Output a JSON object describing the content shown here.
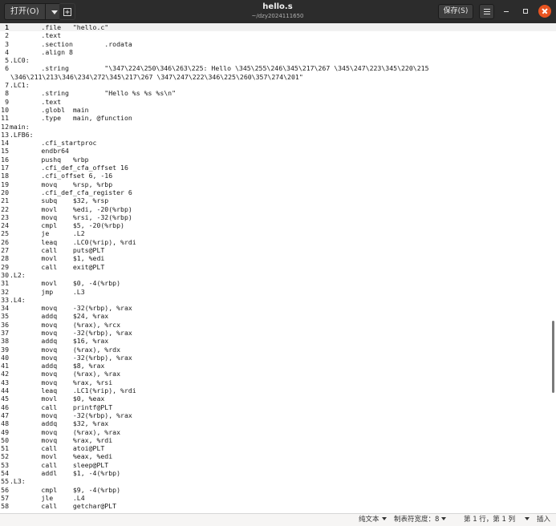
{
  "header": {
    "open_label": "打开(O)",
    "title": "hello.s",
    "subtitle": "~/dzy2024111650",
    "save_label": "保存(S)"
  },
  "editor": {
    "current_line": 1,
    "lines": [
      {
        "n": "1",
        "t": "        .file   \"hello.c\""
      },
      {
        "n": "2",
        "t": "        .text"
      },
      {
        "n": "3",
        "t": "        .section        .rodata"
      },
      {
        "n": "4",
        "t": "        .align 8"
      },
      {
        "n": "5",
        "t": ".LC0:"
      },
      {
        "n": "6",
        "t": "        .string         \"\\347\\224\\250\\346\\263\\225: Hello \\345\\255\\246\\345\\217\\267 \\345\\247\\223\\345\\220\\215"
      },
      {
        "n": "",
        "t": "\\346\\211\\213\\346\\234\\272\\345\\217\\267 \\347\\247\\222\\346\\225\\260\\357\\274\\201\""
      },
      {
        "n": "7",
        "t": ".LC1:"
      },
      {
        "n": "8",
        "t": "        .string         \"Hello %s %s %s\\n\""
      },
      {
        "n": "9",
        "t": "        .text"
      },
      {
        "n": "10",
        "t": "        .globl  main"
      },
      {
        "n": "11",
        "t": "        .type   main, @function"
      },
      {
        "n": "12",
        "t": "main:"
      },
      {
        "n": "13",
        "t": ".LFB6:"
      },
      {
        "n": "14",
        "t": "        .cfi_startproc"
      },
      {
        "n": "15",
        "t": "        endbr64"
      },
      {
        "n": "16",
        "t": "        pushq   %rbp"
      },
      {
        "n": "17",
        "t": "        .cfi_def_cfa_offset 16"
      },
      {
        "n": "18",
        "t": "        .cfi_offset 6, -16"
      },
      {
        "n": "19",
        "t": "        movq    %rsp, %rbp"
      },
      {
        "n": "20",
        "t": "        .cfi_def_cfa_register 6"
      },
      {
        "n": "21",
        "t": "        subq    $32, %rsp"
      },
      {
        "n": "22",
        "t": "        movl    %edi, -20(%rbp)"
      },
      {
        "n": "23",
        "t": "        movq    %rsi, -32(%rbp)"
      },
      {
        "n": "24",
        "t": "        cmpl    $5, -20(%rbp)"
      },
      {
        "n": "25",
        "t": "        je      .L2"
      },
      {
        "n": "26",
        "t": "        leaq    .LC0(%rip), %rdi"
      },
      {
        "n": "27",
        "t": "        call    puts@PLT"
      },
      {
        "n": "28",
        "t": "        movl    $1, %edi"
      },
      {
        "n": "29",
        "t": "        call    exit@PLT"
      },
      {
        "n": "30",
        "t": ".L2:"
      },
      {
        "n": "31",
        "t": "        movl    $0, -4(%rbp)"
      },
      {
        "n": "32",
        "t": "        jmp     .L3"
      },
      {
        "n": "33",
        "t": ".L4:"
      },
      {
        "n": "34",
        "t": "        movq    -32(%rbp), %rax"
      },
      {
        "n": "35",
        "t": "        addq    $24, %rax"
      },
      {
        "n": "36",
        "t": "        movq    (%rax), %rcx"
      },
      {
        "n": "37",
        "t": "        movq    -32(%rbp), %rax"
      },
      {
        "n": "38",
        "t": "        addq    $16, %rax"
      },
      {
        "n": "39",
        "t": "        movq    (%rax), %rdx"
      },
      {
        "n": "40",
        "t": "        movq    -32(%rbp), %rax"
      },
      {
        "n": "41",
        "t": "        addq    $8, %rax"
      },
      {
        "n": "42",
        "t": "        movq    (%rax), %rax"
      },
      {
        "n": "43",
        "t": "        movq    %rax, %rsi"
      },
      {
        "n": "44",
        "t": "        leaq    .LC1(%rip), %rdi"
      },
      {
        "n": "45",
        "t": "        movl    $0, %eax"
      },
      {
        "n": "46",
        "t": "        call    printf@PLT"
      },
      {
        "n": "47",
        "t": "        movq    -32(%rbp), %rax"
      },
      {
        "n": "48",
        "t": "        addq    $32, %rax"
      },
      {
        "n": "49",
        "t": "        movq    (%rax), %rax"
      },
      {
        "n": "50",
        "t": "        movq    %rax, %rdi"
      },
      {
        "n": "51",
        "t": "        call    atoi@PLT"
      },
      {
        "n": "52",
        "t": "        movl    %eax, %edi"
      },
      {
        "n": "53",
        "t": "        call    sleep@PLT"
      },
      {
        "n": "54",
        "t": "        addl    $1, -4(%rbp)"
      },
      {
        "n": "55",
        "t": ".L3:"
      },
      {
        "n": "56",
        "t": "        cmpl    $9, -4(%rbp)"
      },
      {
        "n": "57",
        "t": "        jle     .L4"
      },
      {
        "n": "58",
        "t": "        call    getchar@PLT"
      }
    ]
  },
  "statusbar": {
    "language": "纯文本",
    "tab_width": "制表符宽度：8",
    "position": "第 1 行，第 1 列",
    "insert_mode": "插入"
  }
}
